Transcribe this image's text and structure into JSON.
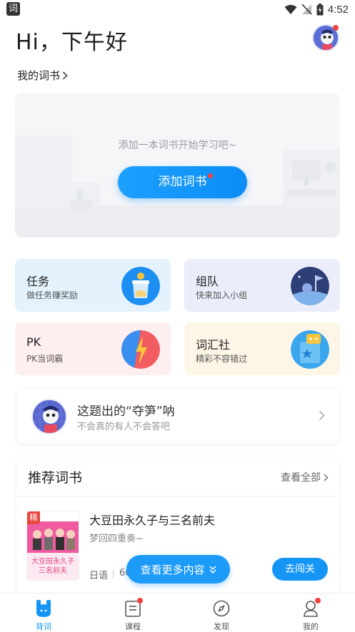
{
  "status_bar": {
    "app_glyph": "词",
    "time": "4:52",
    "icons": [
      "wifi-icon",
      "signal-off-icon",
      "battery-icon"
    ]
  },
  "header": {
    "greeting": "Hi，下午好"
  },
  "my_books": {
    "label": "我的词书",
    "empty_hint": "添加一本词书开始学习吧~",
    "add_button": "添加词书"
  },
  "tiles": [
    {
      "title": "任务",
      "subtitle": "做任务赚奖励",
      "icon": "task-icon",
      "color": "#e3f2fd"
    },
    {
      "title": "组队",
      "subtitle": "快来加入小组",
      "icon": "team-icon",
      "color": "#ebeefa"
    },
    {
      "title": "PK",
      "subtitle": "PK当词霸",
      "icon": "pk-icon",
      "color": "#fdeef0"
    },
    {
      "title": "词汇社",
      "subtitle": "精彩不容错过",
      "icon": "vocab-club-icon",
      "color": "#fdf6e7"
    }
  ],
  "quiz": {
    "title": "这题出的“夺笋”呐",
    "subtitle": "不会真的有人不会答吧"
  },
  "recommend": {
    "title": "推荐词书",
    "view_all": "查看全部",
    "book": {
      "badge": "精",
      "name": "大豆田永久子与三名前夫",
      "description": "梦回四重奏~",
      "language": "日语",
      "count": "66",
      "cover_text": "大豆田永久子 三名前夫",
      "go_button": "去闯关"
    }
  },
  "more_button": "查看更多内容",
  "bottom_nav": [
    {
      "label": "背词",
      "icon": "memorize-icon",
      "active": true
    },
    {
      "label": "课程",
      "icon": "course-icon",
      "active": false
    },
    {
      "label": "发现",
      "icon": "discover-icon",
      "active": false
    },
    {
      "label": "我的",
      "icon": "profile-icon",
      "active": false
    }
  ],
  "colors": {
    "accent": "#1596f7",
    "badge_red": "#f04141"
  }
}
